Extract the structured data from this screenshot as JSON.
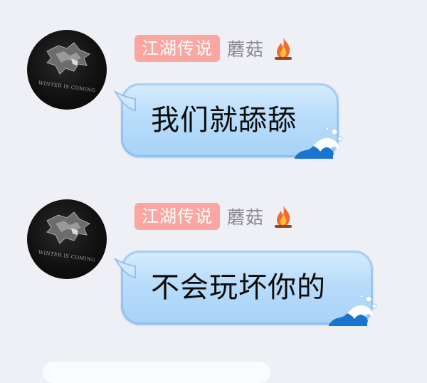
{
  "messages": [
    {
      "avatar_icon": "winter-is-coming-wolf-icon",
      "avatar_text": "WINTER IS COMING",
      "badge": "江湖传说",
      "nickname": "蘑菇",
      "level_icon": "fire-icon",
      "text": "我们就舔舔"
    },
    {
      "avatar_icon": "winter-is-coming-wolf-icon",
      "avatar_text": "WINTER IS COMING",
      "badge": "江湖传说",
      "nickname": "蘑菇",
      "level_icon": "fire-icon",
      "text": "不会玩坏你的"
    }
  ],
  "colors": {
    "background": "#efeff6",
    "badge": "#fba6a0",
    "bubble": "#b9dcfa",
    "nickname": "#8a8a8f"
  }
}
